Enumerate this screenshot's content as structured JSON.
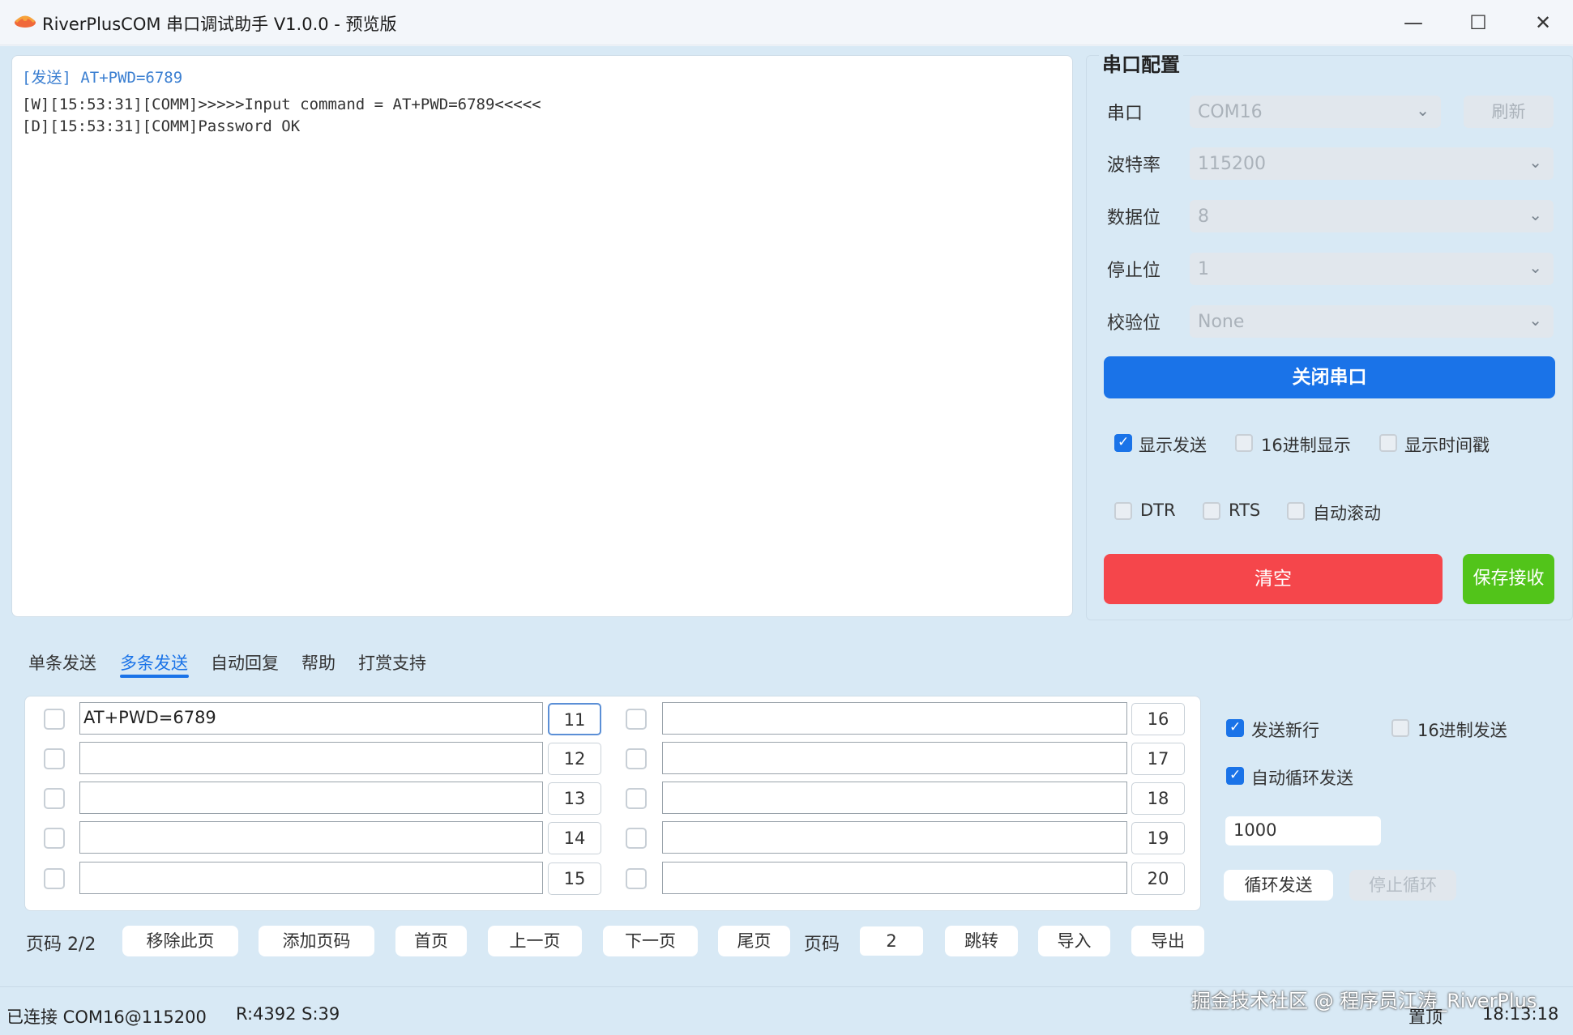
{
  "window": {
    "title": "RiverPlusCOM 串口调试助手 V1.0.0 - 预览版",
    "minimize_glyph": "—",
    "maximize_glyph": "☐",
    "close_glyph": "✕"
  },
  "log": {
    "send_line": "[发送] AT+PWD=6789",
    "lines": [
      "[W][15:53:31][COMM]>>>>>Input command = AT+PWD=6789<<<<<",
      "[D][15:53:31][COMM]Password OK"
    ]
  },
  "config": {
    "title": "串口配置",
    "port_label": "串口",
    "port_value": "COM16",
    "refresh_label": "刷新",
    "baud_label": "波特率",
    "baud_value": "115200",
    "databits_label": "数据位",
    "databits_value": "8",
    "stopbits_label": "停止位",
    "stopbits_value": "1",
    "parity_label": "校验位",
    "parity_value": "None",
    "close_port_label": "关闭串口",
    "show_send": {
      "label": "显示发送",
      "checked": true
    },
    "hex_display": {
      "label": "16进制显示",
      "checked": false
    },
    "show_timestamp": {
      "label": "显示时间戳",
      "checked": false
    },
    "dtr": {
      "label": "DTR",
      "checked": false
    },
    "rts": {
      "label": "RTS",
      "checked": false
    },
    "auto_scroll": {
      "label": "自动滚动",
      "checked": false
    },
    "clear_label": "清空",
    "save_label": "保存接收"
  },
  "tabs": [
    {
      "label": "单条发送",
      "active": false
    },
    {
      "label": "多条发送",
      "active": true
    },
    {
      "label": "自动回复",
      "active": false
    },
    {
      "label": "帮助",
      "active": false
    },
    {
      "label": "打赏支持",
      "active": false
    }
  ],
  "multi_send": {
    "left_rows": [
      {
        "value": "AT+PWD=6789",
        "number": "11"
      },
      {
        "value": "",
        "number": "12"
      },
      {
        "value": "",
        "number": "13"
      },
      {
        "value": "",
        "number": "14"
      },
      {
        "value": "",
        "number": "15"
      }
    ],
    "right_rows": [
      {
        "value": "",
        "number": "16"
      },
      {
        "value": "",
        "number": "17"
      },
      {
        "value": "",
        "number": "18"
      },
      {
        "value": "",
        "number": "19"
      },
      {
        "value": "",
        "number": "20"
      }
    ]
  },
  "send_options": {
    "send_newline": {
      "label": "发送新行",
      "checked": true
    },
    "hex_send": {
      "label": "16进制发送",
      "checked": false
    },
    "auto_loop": {
      "label": "自动循环发送",
      "checked": true
    },
    "interval_value": "1000",
    "loop_send_label": "循环发送",
    "stop_loop_label": "停止循环"
  },
  "pager": {
    "page_info": "页码 2/2",
    "remove_page": "移除此页",
    "add_page": "添加页码",
    "first": "首页",
    "prev": "上一页",
    "next": "下一页",
    "last": "尾页",
    "page_label": "页码",
    "page_value": "2",
    "jump": "跳转",
    "import": "导入",
    "export": "导出"
  },
  "status": {
    "connection": "已连接 COM16@115200",
    "rx_tx": "R:4392 S:39",
    "pin_top": "置顶",
    "time": "18:13:18",
    "watermark": "掘金技术社区 @ 程序员江涛_RiverPlus"
  },
  "colors": {
    "accent": "#1a73e8",
    "danger": "#f5464b",
    "success": "#52c41a",
    "panel_bg": "#d8e9f5"
  }
}
